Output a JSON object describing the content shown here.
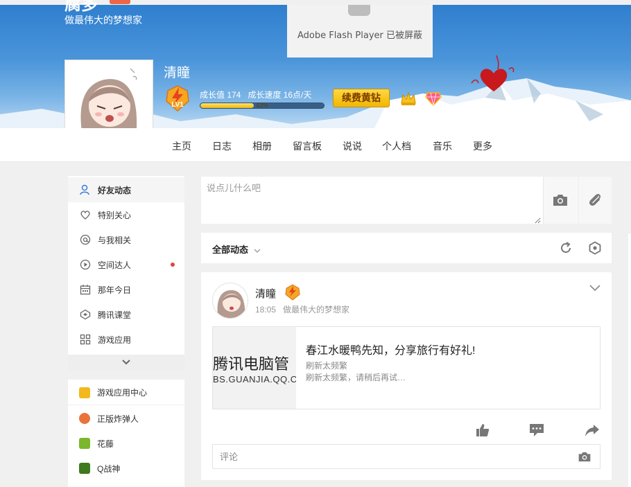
{
  "header": {
    "brand": "腐多",
    "motto": "做最伟大的梦想家",
    "flash_notice": "Adobe Flash Player 已被屏蔽",
    "user_name": "清瞳",
    "level": "LV1",
    "growth_value": "成长值 174",
    "growth_speed": "成长速度 16点/天",
    "progress_percent": 43,
    "progress_label": "43%",
    "renew_label": "续费黄钻"
  },
  "nav": {
    "items": [
      "主页",
      "日志",
      "相册",
      "留言板",
      "说说",
      "个人档",
      "音乐",
      "更多"
    ]
  },
  "sidebar": {
    "items": [
      {
        "label": "好友动态",
        "icon": "user-icon",
        "active": true
      },
      {
        "label": "特别关心",
        "icon": "heart-icon"
      },
      {
        "label": "与我相关",
        "icon": "at-icon"
      },
      {
        "label": "空间达人",
        "icon": "play-icon",
        "dot": true
      },
      {
        "label": "那年今日",
        "icon": "calendar-icon"
      },
      {
        "label": "腾讯课堂",
        "icon": "course-icon"
      },
      {
        "label": "游戏应用",
        "icon": "grid-icon"
      }
    ],
    "games": [
      {
        "label": "游戏应用中心",
        "color": "#f3b81c"
      },
      {
        "label": "正版炸弹人",
        "color": "#e8743b"
      },
      {
        "label": "花藤",
        "color": "#7bb62c"
      },
      {
        "label": "Q战神",
        "color": "#3d7a1e"
      }
    ]
  },
  "composer": {
    "placeholder": "说点儿什么吧"
  },
  "filter": {
    "label": "全部动态"
  },
  "feed": {
    "author": "清瞳",
    "time": "18:05",
    "signature": "做最伟大的梦想家",
    "share": {
      "thumb_title": "腾讯电脑管",
      "thumb_url": "BS.GUANJIA.QQ.C",
      "title": "春江水暖鸭先知，分享旅行有好礼!",
      "sub1": "刷新太频繁",
      "sub2": "刷新太频繁，请稍后再试…"
    },
    "comment_placeholder": "评论"
  },
  "colors": {
    "banner": "#3a87d4",
    "gold": "#f2b600",
    "dot": "#e0463c"
  }
}
